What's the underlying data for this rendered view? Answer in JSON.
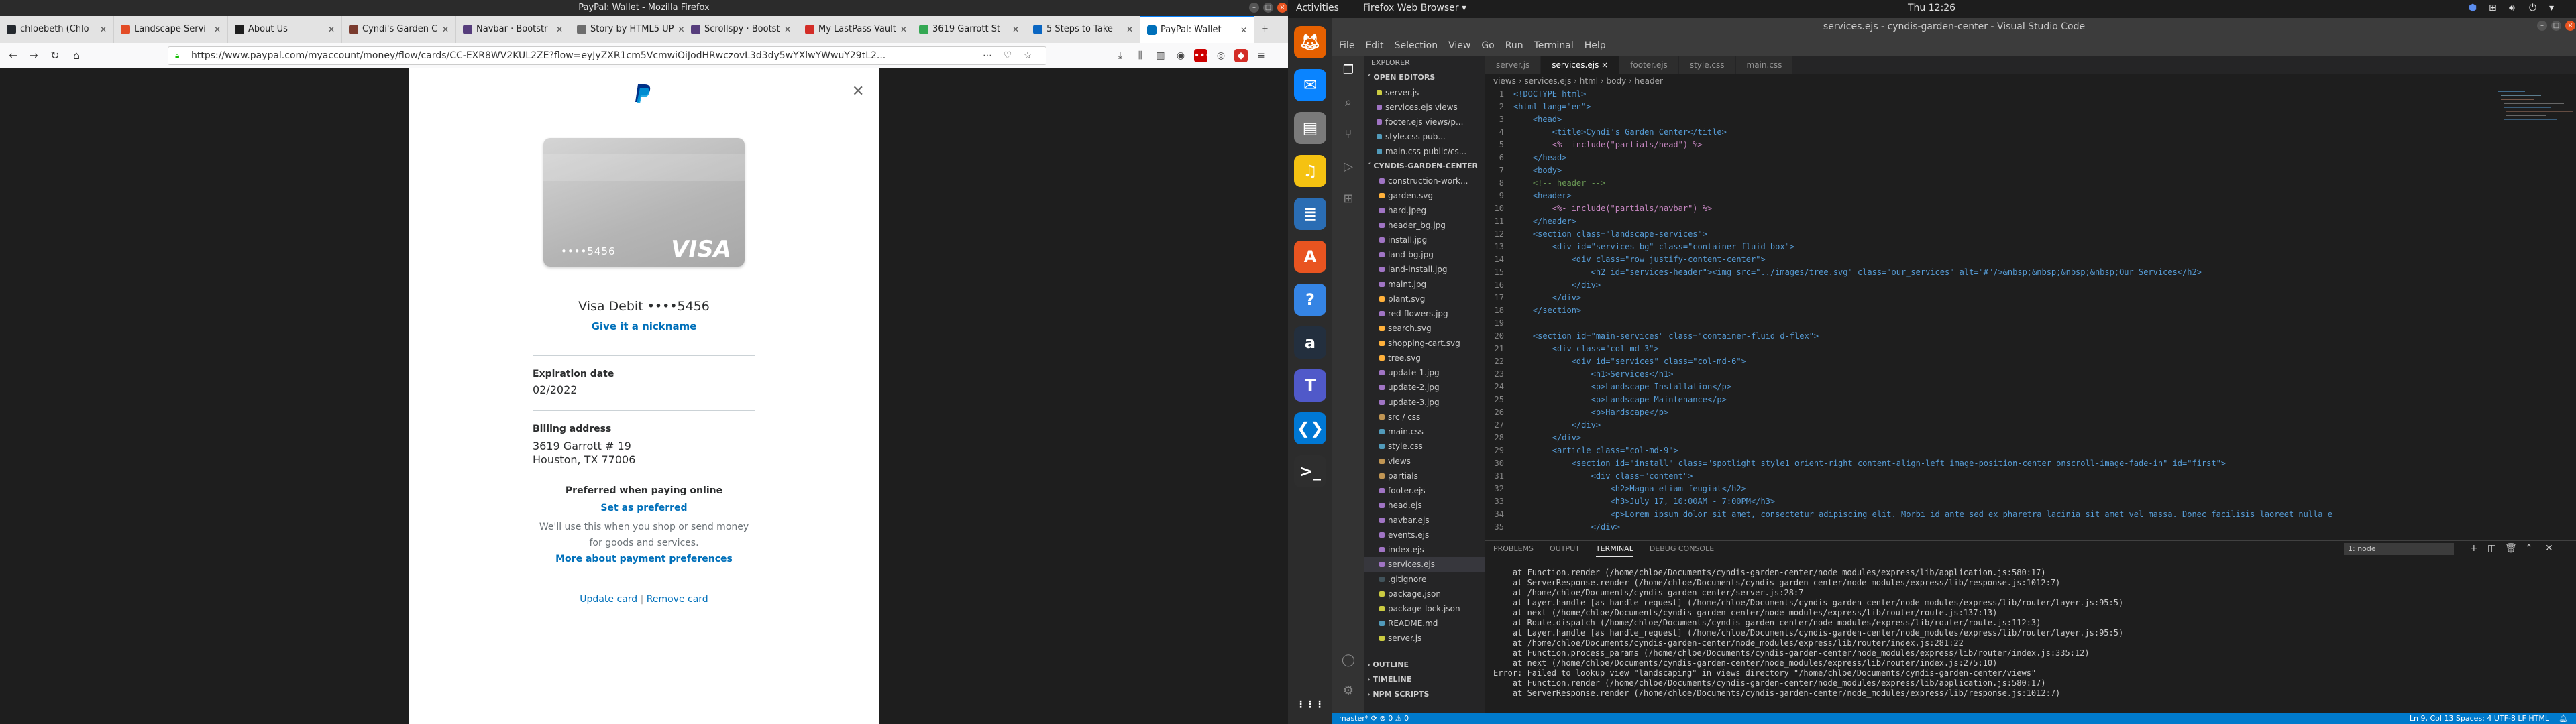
{
  "firefox": {
    "window_title": "PayPal: Wallet - Mozilla Firefox",
    "tabs": [
      {
        "label": "chloebeth (Chlo",
        "color": "#24292e"
      },
      {
        "label": "Landscape Servi",
        "color": "#e34c26"
      },
      {
        "label": "About Us",
        "color": "#1e1e1e"
      },
      {
        "label": "Cyndi's Garden C",
        "color": "#7a3b2e"
      },
      {
        "label": "Navbar · Bootstr",
        "color": "#563d7c"
      },
      {
        "label": "Story by HTML5 UP",
        "color": "#6d6d6d"
      },
      {
        "label": "Scrollspy · Bootst",
        "color": "#563d7c"
      },
      {
        "label": "My LastPass Vault",
        "color": "#d32d27"
      },
      {
        "label": "3619 Garrott St",
        "color": "#34a853"
      },
      {
        "label": "5 Steps to Take",
        "color": "#0a66c2"
      },
      {
        "label": "PayPal: Wallet",
        "color": "#0070ba"
      }
    ],
    "url": "https://www.paypal.com/myaccount/money/flow/cards/CC-EXR8WV2KUL2ZE?flow=eyJyZXR1cm5VcmwiOiJodHRwczovL3d3dy5wYXlwYWwuY29tL2..."
  },
  "paypal": {
    "card_number": "••••5456",
    "card_brand": "VISA",
    "card_title": "Visa Debit ••••5456",
    "nickname_link": "Give it a nickname",
    "expiration_label": "Expiration date",
    "expiration_value": "02/2022",
    "billing_label": "Billing address",
    "billing_line1": "3619 Garrott # 19",
    "billing_line2": "Houston, TX 77006",
    "preferred_title": "Preferred when paying online",
    "preferred_link": "Set as preferred",
    "preferred_desc": "We'll use this when you shop or send money for goods and services.",
    "preferred_more": "More about payment preferences",
    "update_card": "Update card",
    "separator": "|",
    "remove_card": "Remove card"
  },
  "ubuntu": {
    "activities": "Activities",
    "app_name": "Firefox Web Browser ▾",
    "clock": "Thu 12:26",
    "dock": [
      {
        "name": "firefox",
        "color": "#e66000"
      },
      {
        "name": "thunderbird",
        "color": "#0a84ff"
      },
      {
        "name": "files",
        "color": "#7a7a7a"
      },
      {
        "name": "rhythmbox",
        "color": "#f5c211"
      },
      {
        "name": "writer",
        "color": "#2a6db4"
      },
      {
        "name": "software",
        "color": "#e95420"
      },
      {
        "name": "help",
        "color": "#3584e4"
      },
      {
        "name": "amazon",
        "color": "#232f3e"
      },
      {
        "name": "teams",
        "color": "#5059c9"
      },
      {
        "name": "vscode",
        "color": "#0078d4"
      },
      {
        "name": "terminal",
        "color": "#2e2e2e"
      }
    ]
  },
  "vscode": {
    "title": "services.ejs - cyndis-garden-center - Visual Studio Code",
    "menu": [
      "File",
      "Edit",
      "Selection",
      "View",
      "Go",
      "Run",
      "Terminal",
      "Help"
    ],
    "explorer_title": "EXPLORER",
    "open_editors_label": "OPEN EDITORS",
    "open_editors": [
      {
        "name": "server.js",
        "color": "#cbcb41"
      },
      {
        "name": "services.ejs views",
        "color": "#a074c4"
      },
      {
        "name": "footer.ejs views/p...",
        "color": "#a074c4"
      },
      {
        "name": "style.css pub...",
        "color": "#519aba"
      },
      {
        "name": "main.css public/cs...",
        "color": "#519aba"
      }
    ],
    "project_label": "CYNDIS-GARDEN-CENTER",
    "files": [
      {
        "name": "construction-work...",
        "color": "#a074c4",
        "sel": false
      },
      {
        "name": "garden.svg",
        "color": "#ffb13b",
        "sel": false
      },
      {
        "name": "hard.jpeg",
        "color": "#a074c4",
        "sel": false
      },
      {
        "name": "header_bg.jpg",
        "color": "#a074c4",
        "sel": false
      },
      {
        "name": "install.jpg",
        "color": "#a074c4",
        "sel": false
      },
      {
        "name": "land-bg.jpg",
        "color": "#a074c4",
        "sel": false
      },
      {
        "name": "land-install.jpg",
        "color": "#a074c4",
        "sel": false
      },
      {
        "name": "maint.jpg",
        "color": "#a074c4",
        "sel": false
      },
      {
        "name": "plant.svg",
        "color": "#ffb13b",
        "sel": false
      },
      {
        "name": "red-flowers.jpg",
        "color": "#a074c4",
        "sel": false
      },
      {
        "name": "search.svg",
        "color": "#ffb13b",
        "sel": false
      },
      {
        "name": "shopping-cart.svg",
        "color": "#ffb13b",
        "sel": false
      },
      {
        "name": "tree.svg",
        "color": "#ffb13b",
        "sel": false
      },
      {
        "name": "update-1.jpg",
        "color": "#a074c4",
        "sel": false
      },
      {
        "name": "update-2.jpg",
        "color": "#a074c4",
        "sel": false
      },
      {
        "name": "update-3.jpg",
        "color": "#a074c4",
        "sel": false
      },
      {
        "name": "src / css",
        "color": "#c09553",
        "sel": false
      },
      {
        "name": "main.css",
        "color": "#519aba",
        "sel": false
      },
      {
        "name": "style.css",
        "color": "#519aba",
        "sel": false
      },
      {
        "name": "views",
        "color": "#c09553",
        "sel": false
      },
      {
        "name": "partials",
        "color": "#c09553",
        "sel": false
      },
      {
        "name": "footer.ejs",
        "color": "#a074c4",
        "sel": false
      },
      {
        "name": "head.ejs",
        "color": "#a074c4",
        "sel": false
      },
      {
        "name": "navbar.ejs",
        "color": "#a074c4",
        "sel": false
      },
      {
        "name": "events.ejs",
        "color": "#a074c4",
        "sel": false
      },
      {
        "name": "index.ejs",
        "color": "#a074c4",
        "sel": false
      },
      {
        "name": "services.ejs",
        "color": "#a074c4",
        "sel": true
      },
      {
        "name": ".gitignore",
        "color": "#41535b",
        "sel": false
      },
      {
        "name": "package.json",
        "color": "#cbcb41",
        "sel": false
      },
      {
        "name": "package-lock.json",
        "color": "#cbcb41",
        "sel": false
      },
      {
        "name": "README.md",
        "color": "#519aba",
        "sel": false
      },
      {
        "name": "server.js",
        "color": "#cbcb41",
        "sel": false
      }
    ],
    "outline_label": "OUTLINE",
    "timeline_label": "TIMELINE",
    "npm_label": "NPM SCRIPTS",
    "editor_tabs": [
      {
        "label": "server.js",
        "active": false
      },
      {
        "label": "services.ejs ×",
        "active": true
      },
      {
        "label": "footer.ejs",
        "active": false
      },
      {
        "label": "style.css",
        "active": false
      },
      {
        "label": "main.css",
        "active": false
      }
    ],
    "breadcrumb": "views › services.ejs › html › body › header",
    "code": [
      "<!DOCTYPE html>",
      "<html lang=\"en\">",
      "    <head>",
      "        <title>Cyndi's Garden Center</title>",
      "        <%- include(\"partials/head\") %>",
      "    </head>",
      "    <body>",
      "    <!-- header -->",
      "    <header>",
      "        <%- include(\"partials/navbar\") %>",
      "    </header>",
      "    <section class=\"landscape-services\">",
      "        <div id=\"services-bg\" class=\"container-fluid box\">",
      "            <div class=\"row justify-content-center\">",
      "                <h2 id=\"services-header\"><img src=\"../images/tree.svg\" class=\"our_services\" alt=\"#\"/>&nbsp;&nbsp;&nbsp;&nbsp;Our Services</h2>",
      "            </div>",
      "        </div>",
      "    </section>",
      "",
      "    <section id=\"main-services\" class=\"container-fluid d-flex\">",
      "        <div class=\"col-md-3\">",
      "            <div id=\"services\" class=\"col-md-6\">",
      "                <h1>Services</h1>",
      "                <p>Landscape Installation</p>",
      "                <p>Landscape Maintenance</p>",
      "                <p>Hardscape</p>",
      "            </div>",
      "        </div>",
      "        <article class=\"col-md-9\">",
      "            <section id=\"install\" class=\"spotlight style1 orient-right content-align-left image-position-center onscroll-image-fade-in\" id=\"first\">",
      "                <div class=\"content\">",
      "                    <h2>Magna etiam feugiat</h2>",
      "                    <h3>July 17, 10:00AM - 7:00PM</h3>",
      "                    <p>Lorem ipsum dolor sit amet, consectetur adipiscing elit. Morbi id ante sed ex pharetra lacinia sit amet vel massa. Donec facilisis laoreet nulla e",
      "                </div>"
    ],
    "panel_tabs": [
      "PROBLEMS",
      "OUTPUT",
      "TERMINAL",
      "DEBUG CONSOLE"
    ],
    "terminal_select": "1: node",
    "terminal": [
      "    at Function.render (/home/chloe/Documents/cyndis-garden-center/node_modules/express/lib/application.js:580:17)",
      "    at ServerResponse.render (/home/chloe/Documents/cyndis-garden-center/node_modules/express/lib/response.js:1012:7)",
      "    at /home/chloe/Documents/cyndis-garden-center/server.js:28:7",
      "    at Layer.handle [as handle_request] (/home/chloe/Documents/cyndis-garden-center/node_modules/express/lib/router/layer.js:95:5)",
      "    at next (/home/chloe/Documents/cyndis-garden-center/node_modules/express/lib/router/route.js:137:13)",
      "    at Route.dispatch (/home/chloe/Documents/cyndis-garden-center/node_modules/express/lib/router/route.js:112:3)",
      "    at Layer.handle [as handle_request] (/home/chloe/Documents/cyndis-garden-center/node_modules/express/lib/router/layer.js:95:5)",
      "    at /home/chloe/Documents/cyndis-garden-center/node_modules/express/lib/router/index.js:281:22",
      "    at Function.process_params (/home/chloe/Documents/cyndis-garden-center/node_modules/express/lib/router/index.js:335:12)",
      "    at next (/home/chloe/Documents/cyndis-garden-center/node_modules/express/lib/router/index.js:275:10)",
      "Error: Failed to lookup view \"landscaping\" in views directory \"/home/chloe/Documents/cyndis-garden-center/views\"",
      "    at Function.render (/home/chloe/Documents/cyndis-garden-center/node_modules/express/lib/application.js:580:17)",
      "    at ServerResponse.render (/home/chloe/Documents/cyndis-garden-center/node_modules/express/lib/response.js:1012:7)"
    ],
    "status_left": "master*   ⟳   ⊗ 0 ⚠ 0",
    "status_right": "Ln 9, Col 13    Spaces: 4    UTF-8    LF    HTML"
  }
}
